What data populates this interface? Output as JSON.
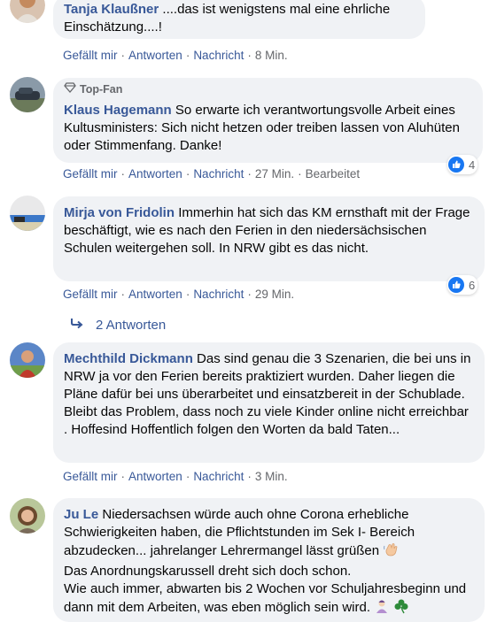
{
  "comments": [
    {
      "author": "Tanja Klaußner",
      "text": "....das ist wenigstens mal eine ehrliche Einschätzung....!",
      "actions": {
        "like": "Gefällt mir",
        "reply": "Antworten",
        "message": "Nachricht",
        "time": "8 Min."
      }
    },
    {
      "badge": "Top-Fan",
      "author": "Klaus Hagemann",
      "text": "So erwarte ich verantwortungsvolle Arbeit eines Kultusministers: Sich nicht hetzen oder treiben lassen von Aluhüten oder Stimmenfang. Danke!",
      "actions": {
        "like": "Gefällt mir",
        "reply": "Antworten",
        "message": "Nachricht",
        "time": "27 Min.",
        "edited": "Bearbeitet"
      },
      "reactions": "4"
    },
    {
      "author": "Mirja von Fridolin",
      "text": "Immerhin hat sich das KM ernsthaft mit der Frage beschäftigt, wie es nach den Ferien in den niedersächsischen Schulen weitergehen soll. In NRW gibt es das nicht.",
      "actions": {
        "like": "Gefällt mir",
        "reply": "Antworten",
        "message": "Nachricht",
        "time": "29 Min."
      },
      "reactions": "6",
      "replies_label": "2 Antworten"
    },
    {
      "author": "Mechthild Dickmann",
      "text": "Das sind genau die 3 Szenarien, die bei uns in NRW ja vor den Ferien bereits praktiziert wurden. Daher liegen die Pläne dafür bei uns überarbeitet und einsatzbereit in der Schublade. Bleibt das Problem, dass noch zu viele Kinder online nicht erreichbar . Hoffesind Hoffentlich folgen den Worten da bald Taten...",
      "actions": {
        "like": "Gefällt mir",
        "reply": "Antworten",
        "message": "Nachricht",
        "time": "3 Min."
      }
    },
    {
      "author": "Ju Le",
      "text_a": "Niedersachsen würde auch ohne Corona erhebliche Schwierigkeiten haben, die Pflichtstunden im Sek I- Bereich abzudecken... jahrelanger Lehrermangel lässt grüßen",
      "text_b": "Das Anordnungskarussell dreht sich doch schon.",
      "text_c": "Wie auch immer, abwarten bis 2 Wochen vor Schuljahresbeginn und dann mit dem Arbeiten, was eben möglich sein wird."
    }
  ],
  "icons": {
    "like": "thumbs-up-icon",
    "reply_arrow": "reply-arrow-icon",
    "badge": "diamond-icon"
  },
  "colors": {
    "link": "#385898",
    "bubble": "#f0f2f5",
    "meta": "#65676b",
    "like": "#1877f2"
  }
}
